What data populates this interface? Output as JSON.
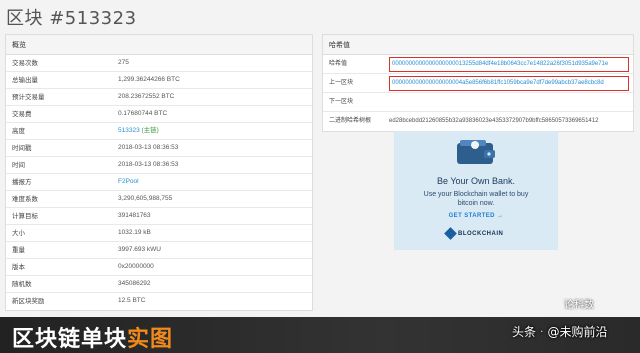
{
  "page": {
    "title": "区块 #513323"
  },
  "summary": {
    "heading": "概览",
    "rows": [
      {
        "label": "交易次数",
        "value": "275"
      },
      {
        "label": "总输出量",
        "value": "1,299.36244266 BTC"
      },
      {
        "label": "预计交易量",
        "value": "208.23672552 BTC"
      },
      {
        "label": "交易费",
        "value": "0.17680744 BTC"
      },
      {
        "label": "高度",
        "value": "513323",
        "suffix": "(主链)"
      },
      {
        "label": "时间戳",
        "value": "2018-03-13 08:36:53"
      },
      {
        "label": "时间",
        "value": "2018-03-13 08:36:53"
      },
      {
        "label": "播报方",
        "value": "F2Pool"
      },
      {
        "label": "难度系数",
        "value": "3,290,605,988,755"
      },
      {
        "label": "计算目标",
        "value": "391481763"
      },
      {
        "label": "大小",
        "value": "1032.19 kB"
      },
      {
        "label": "重量",
        "value": "3997.693 kWU"
      },
      {
        "label": "版本",
        "value": "0x20000000"
      },
      {
        "label": "随机数",
        "value": "345086292"
      },
      {
        "label": "新区块奖励",
        "value": "12.5 BTC"
      }
    ]
  },
  "hashes": {
    "heading": "哈希值",
    "rows": [
      {
        "label": "哈希值",
        "value": "0000000000000000000013255d84df4e18b0643cc7e14822a26f3051d935a9e71e"
      },
      {
        "label": "上一区块",
        "value": "000000000000000000004a5e856f6b81ffc1059bca9e7df7de99abcb37ae8cbc8d"
      },
      {
        "label": "下一区块",
        "value": ""
      },
      {
        "label": "二进制哈希树根",
        "value": "ed28bcebdd21260855b32a93836023e4353372907b9bffc58650573369651412"
      }
    ]
  },
  "ad": {
    "title": "Be Your Own Bank.",
    "subtitle": "Use your Blockchain wallet to buy bitcoin now.",
    "cta": "GET STARTED →",
    "brand": "BLOCKCHAIN",
    "icon": "wallet-icon"
  },
  "banner": {
    "title_plain": "区块链单块",
    "title_highlight": "实图"
  },
  "watermark": {
    "top": "论科数",
    "left": "头条",
    "right": "@未购前沿"
  },
  "colors": {
    "link": "#2a8fd0",
    "highlight_box": "#d9322c",
    "banner_accent": "#f08a1c"
  }
}
